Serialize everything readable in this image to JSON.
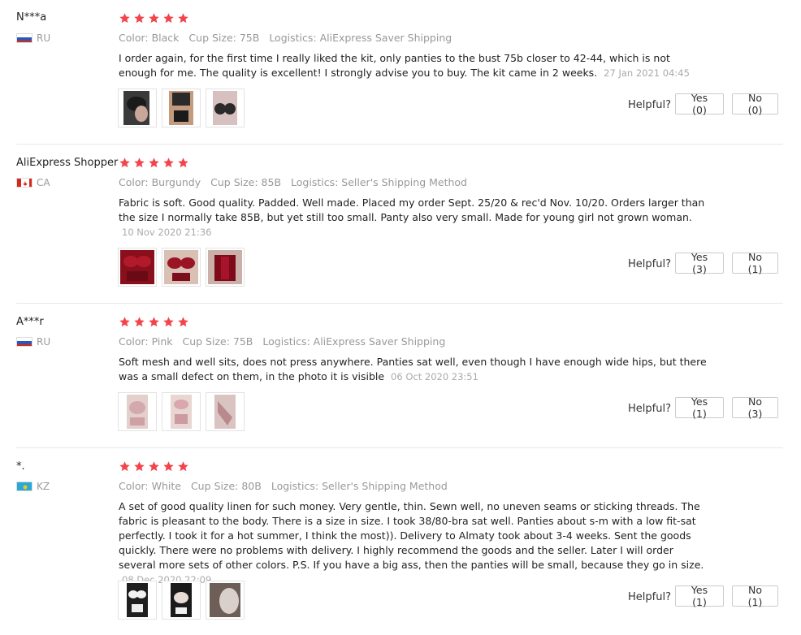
{
  "colors": {
    "star": "#f2444b",
    "accent_text": "#999999"
  },
  "labels": {
    "helpful": "Helpful?"
  },
  "reviews": [
    {
      "user": "N***a",
      "country": "RU",
      "flag": "russia",
      "stars": 5,
      "color": "Color: Black",
      "cup": "Cup Size: 75B",
      "logistics": "Logistics: AliExpress Saver Shipping",
      "text": "I order again, for the first time I really liked the kit, only panties to the bust 75b closer to 42-44, which is not enough for me. The quality is excellent! I strongly advise you to buy. The kit came in 2 weeks.",
      "date": "27 Jan 2021 04:45",
      "yes": "Yes (0)",
      "no": "No (0)",
      "thumbs": [
        "black-bra-photo",
        "black-bra-photo",
        "black-bra-photo"
      ]
    },
    {
      "user": "AliExpress Shopper",
      "country": "CA",
      "flag": "canada",
      "stars": 5,
      "color": "Color: Burgundy",
      "cup": "Cup Size: 85B",
      "logistics": "Logistics: Seller's Shipping Method",
      "text": "Fabric is soft. Good quality. Padded. Well made. Placed my order Sept. 25/20 & rec'd Nov. 10/20. Orders larger than the size I normally take 85B, but yet still too small. Panty also very small. Made for young girl not grown woman.",
      "date": "10 Nov 2020 21:36",
      "yes": "Yes (3)",
      "no": "No (1)",
      "thumbs": [
        "burgundy-bra-photo",
        "burgundy-bra-photo",
        "burgundy-bra-photo"
      ]
    },
    {
      "user": "A***r",
      "country": "RU",
      "flag": "russia",
      "stars": 5,
      "color": "Color: Pink",
      "cup": "Cup Size: 75B",
      "logistics": "Logistics: AliExpress Saver Shipping",
      "text": "Soft mesh and well sits, does not press anywhere. Panties sat well, even though I have enough wide hips, but there was a small defect on them, in the photo it is visible",
      "date": "06 Oct 2020 23:51",
      "yes": "Yes (1)",
      "no": "No (3)",
      "thumbs": [
        "pink-lingerie-photo",
        "pink-lingerie-photo",
        "pink-lingerie-photo"
      ]
    },
    {
      "user": "*.",
      "country": "KZ",
      "flag": "kazakhstan",
      "stars": 5,
      "color": "Color: White",
      "cup": "Cup Size: 80B",
      "logistics": "Logistics: Seller's Shipping Method",
      "text": "A set of good quality linen for such money. Very gentle, thin. Sewn well, no uneven seams or sticking threads. The fabric is pleasant to the body. There is a size in size. I took 38/80-bra sat well. Panties about s-m with a low fit-sat perfectly. I took it for a hot summer, I think the most)). Delivery to Almaty took about 3-4 weeks. Sent the goods quickly. There were no problems with delivery. I highly recommend the goods and the seller. Later I will order several more sets of other colors. P.S. If you have a big ass, then the panties will be small, because they go in size.",
      "date": "08 Dec 2020 22:09",
      "yes": "Yes (1)",
      "no": "No (1)",
      "thumbs": [
        "white-lingerie-photo",
        "white-lingerie-photo",
        "white-lingerie-photo"
      ]
    }
  ]
}
